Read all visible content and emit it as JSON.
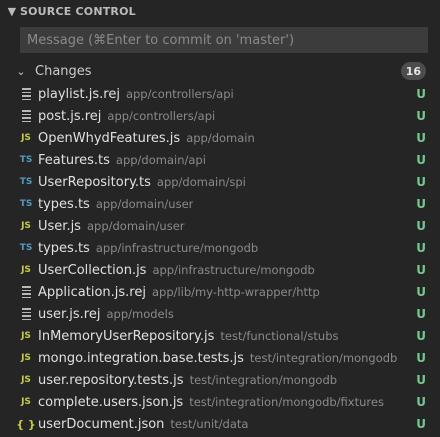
{
  "panel": {
    "title": "SOURCE CONTROL"
  },
  "commit": {
    "placeholder": "Message (⌘Enter to commit on 'master')"
  },
  "changes": {
    "label": "Changes",
    "count": "16",
    "files": [
      {
        "icon": "rej",
        "name": "playlist.js.rej",
        "path": "app/controllers/api",
        "status": "U"
      },
      {
        "icon": "rej",
        "name": "post.js.rej",
        "path": "app/controllers/api",
        "status": "U"
      },
      {
        "icon": "js",
        "name": "OpenWhydFeatures.js",
        "path": "app/domain",
        "status": "U"
      },
      {
        "icon": "ts",
        "name": "Features.ts",
        "path": "app/domain/api",
        "status": "U"
      },
      {
        "icon": "ts",
        "name": "UserRepository.ts",
        "path": "app/domain/spi",
        "status": "U"
      },
      {
        "icon": "ts",
        "name": "types.ts",
        "path": "app/domain/user",
        "status": "U"
      },
      {
        "icon": "js",
        "name": "User.js",
        "path": "app/domain/user",
        "status": "U"
      },
      {
        "icon": "ts",
        "name": "types.ts",
        "path": "app/infrastructure/mongodb",
        "status": "U"
      },
      {
        "icon": "js",
        "name": "UserCollection.js",
        "path": "app/infrastructure/mongodb",
        "status": "U"
      },
      {
        "icon": "rej",
        "name": "Application.js.rej",
        "path": "app/lib/my-http-wrapper/http",
        "status": "U"
      },
      {
        "icon": "rej",
        "name": "user.js.rej",
        "path": "app/models",
        "status": "U"
      },
      {
        "icon": "js",
        "name": "InMemoryUserRepository.js",
        "path": "test/functional/stubs",
        "status": "U"
      },
      {
        "icon": "js",
        "name": "mongo.integration.base.tests.js",
        "path": "test/integration/mongodb",
        "status": "U"
      },
      {
        "icon": "js",
        "name": "user.repository.tests.js",
        "path": "test/integration/mongodb",
        "status": "U"
      },
      {
        "icon": "js",
        "name": "complete.users.json.js",
        "path": "test/integration/mongodb/fixtures",
        "status": "U"
      },
      {
        "icon": "json",
        "name": "userDocument.json",
        "path": "test/unit/data",
        "status": "U"
      }
    ]
  },
  "icons": {
    "js": "JS",
    "ts": "TS",
    "json": "{ }"
  },
  "colors": {
    "js": "#cbcb41",
    "ts": "#519aba",
    "untracked": "#73c991",
    "background": "#252526"
  }
}
